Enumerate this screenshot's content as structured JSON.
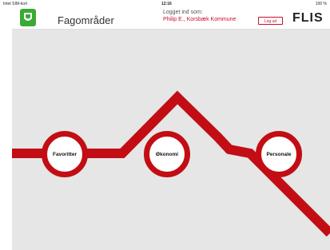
{
  "status_bar": {
    "carrier": "Intet SIM-kort",
    "time": "12:16",
    "battery": "100 %"
  },
  "header": {
    "title": "Fagområder",
    "login_label": "Logget ind som:",
    "user": "Philip E., Korsbæk Kommune",
    "logout": "Log ud",
    "brand": "FLIS"
  },
  "nodes": [
    {
      "id": "favoritter",
      "label": "Favoritter"
    },
    {
      "id": "okonomi",
      "label": "Økonomi"
    },
    {
      "id": "personale",
      "label": "Personale"
    }
  ],
  "colors": {
    "accent": "#c30d14",
    "background": "#e6e6e6",
    "logo_green": "#3aa935"
  }
}
